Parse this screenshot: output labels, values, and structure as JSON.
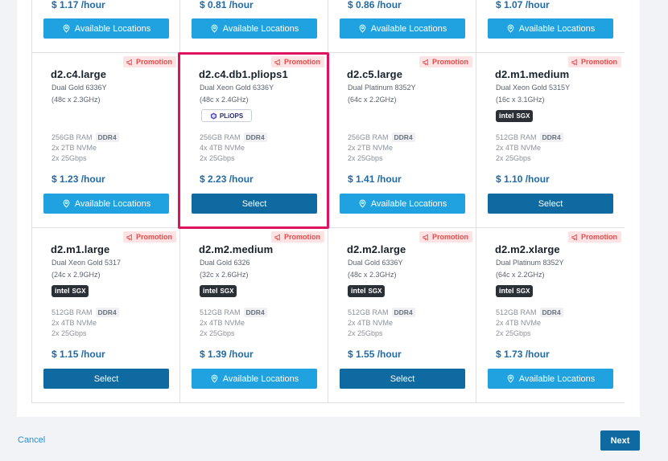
{
  "top_row": [
    {
      "price": "$ 1.17 /hour",
      "button": "Available Locations",
      "button_kind": "loc"
    },
    {
      "price": "$ 0.81 /hour",
      "button": "Available Locations",
      "button_kind": "loc"
    },
    {
      "price": "$ 0.86 /hour",
      "button": "Available Locations",
      "button_kind": "loc"
    },
    {
      "price": "$ 1.07 /hour",
      "button": "Available Locations",
      "button_kind": "loc"
    }
  ],
  "cards": [
    {
      "name": "d2.c4.large",
      "cpu": "Dual Gold 6336Y",
      "cores": "(48c x 2.3GHz)",
      "badge": "",
      "ram": "256GB RAM",
      "ddr": "DDR4",
      "disk": "2x 2TB NVMe",
      "net": "2x 25Gbps",
      "price": "$ 1.23 /hour",
      "button": "Available Locations",
      "button_kind": "loc",
      "promo": "Promotion"
    },
    {
      "name": "d2.c4.db1.pliops1",
      "cpu": "Dual Xeon Gold 6336Y",
      "cores": "(48c x 2.4GHz)",
      "badge": "pliops",
      "ram": "256GB RAM",
      "ddr": "DDR4",
      "disk": "4x 4TB NVMe",
      "net": "2x 25Gbps",
      "price": "$ 2.23 /hour",
      "button": "Select",
      "button_kind": "sel",
      "promo": "Promotion"
    },
    {
      "name": "d2.c5.large",
      "cpu": "Dual Platinum 8352Y",
      "cores": "(64c x 2.2GHz)",
      "badge": "",
      "ram": "256GB RAM",
      "ddr": "DDR4",
      "disk": "2x 2TB NVMe",
      "net": "2x 25Gbps",
      "price": "$ 1.41 /hour",
      "button": "Available Locations",
      "button_kind": "loc",
      "promo": "Promotion"
    },
    {
      "name": "d2.m1.medium",
      "cpu": "Dual Xeon Gold 5315Y",
      "cores": "(16c x 3.1GHz)",
      "badge": "sgx",
      "ram": "512GB RAM",
      "ddr": "DDR4",
      "disk": "2x 4TB NVMe",
      "net": "2x 25Gbps",
      "price": "$ 1.10 /hour",
      "button": "Select",
      "button_kind": "sel",
      "promo": "Promotion"
    },
    {
      "name": "d2.m1.large",
      "cpu": "Dual Xeon Gold 5317",
      "cores": "(24c x 2.9GHz)",
      "badge": "sgx",
      "ram": "512GB RAM",
      "ddr": "DDR4",
      "disk": "2x 4TB NVMe",
      "net": "2x 25Gbps",
      "price": "$ 1.15 /hour",
      "button": "Select",
      "button_kind": "sel",
      "promo": "Promotion"
    },
    {
      "name": "d2.m2.medium",
      "cpu": "Dual Gold 6326",
      "cores": "(32c x 2.6GHz)",
      "badge": "sgx",
      "ram": "512GB RAM",
      "ddr": "DDR4",
      "disk": "2x 4TB NVMe",
      "net": "2x 25Gbps",
      "price": "$ 1.39 /hour",
      "button": "Available Locations",
      "button_kind": "loc",
      "promo": "Promotion"
    },
    {
      "name": "d2.m2.large",
      "cpu": "Dual Gold 6336Y",
      "cores": "(48c x 2.3GHz)",
      "badge": "sgx",
      "ram": "512GB RAM",
      "ddr": "DDR4",
      "disk": "2x 4TB NVMe",
      "net": "2x 25Gbps",
      "price": "$ 1.55 /hour",
      "button": "Select",
      "button_kind": "sel",
      "promo": "Promotion"
    },
    {
      "name": "d2.m2.xlarge",
      "cpu": "Dual Platinum 8352Y",
      "cores": "(64c x 2.2GHz)",
      "badge": "sgx",
      "ram": "512GB RAM",
      "ddr": "DDR4",
      "disk": "2x 4TB NVMe",
      "net": "2x 25Gbps",
      "price": "$ 1.73 /hour",
      "button": "Available Locations",
      "button_kind": "loc",
      "promo": "Promotion"
    }
  ],
  "badges": {
    "intel": "intel",
    "sgx": "SGX",
    "pliops": "PLiOPS"
  },
  "footer": {
    "cancel": "Cancel",
    "next": "Next"
  },
  "colors": {
    "select": "#0f6aa1",
    "locations": "#20a2e0",
    "price": "#1f6aa7",
    "promo_bg": "#fde3e3",
    "promo_text": "#e24b4b",
    "highlight": "#e0115f"
  },
  "icons": {
    "location": "map-pin-icon",
    "promo": "megaphone-tag-icon",
    "pliops": "pliops-logo-icon"
  }
}
